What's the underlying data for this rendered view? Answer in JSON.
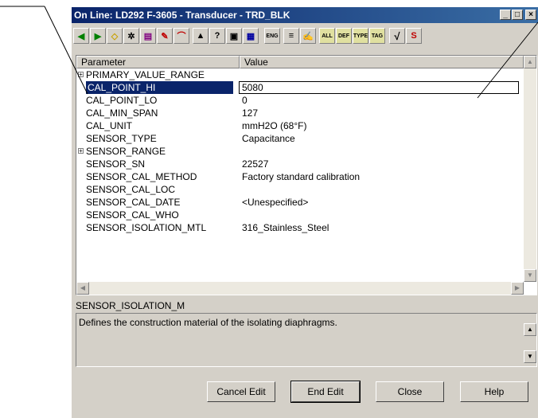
{
  "window": {
    "title": "On Line: LD292 F-3605 - Transducer - TRD_BLK"
  },
  "title_buttons": {
    "minimize": "_",
    "maximize": "□",
    "close": "×"
  },
  "toolbar": {
    "labels": {
      "all": "ALL",
      "def": "DEF",
      "type": "TYPE",
      "tag": "TAG",
      "eng": "ENG",
      "check": "√",
      "s": "S"
    }
  },
  "grid": {
    "headers": {
      "parameter": "Parameter",
      "value": "Value"
    },
    "rows": [
      {
        "name": "PRIMARY_VALUE_RANGE",
        "value": ""
      },
      {
        "name": "CAL_POINT_HI",
        "value": "5080"
      },
      {
        "name": "CAL_POINT_LO",
        "value": "0"
      },
      {
        "name": "CAL_MIN_SPAN",
        "value": "127"
      },
      {
        "name": "CAL_UNIT",
        "value": "mmH2O (68°F)"
      },
      {
        "name": "SENSOR_TYPE",
        "value": "Capacitance"
      },
      {
        "name": "SENSOR_RANGE",
        "value": ""
      },
      {
        "name": "SENSOR_SN",
        "value": "22527"
      },
      {
        "name": "SENSOR_CAL_METHOD",
        "value": "Factory standard calibration"
      },
      {
        "name": "SENSOR_CAL_LOC",
        "value": ""
      },
      {
        "name": "SENSOR_CAL_DATE",
        "value": "<Unespecified>"
      },
      {
        "name": "SENSOR_CAL_WHO",
        "value": ""
      },
      {
        "name": "SENSOR_ISOLATION_MTL",
        "value": "316_Stainless_Steel"
      }
    ]
  },
  "description": {
    "label": "SENSOR_ISOLATION_M",
    "text": "Defines the construction material of the isolating diaphragms."
  },
  "buttons": {
    "cancel_edit": "Cancel Edit",
    "end_edit": "End Edit",
    "close": "Close",
    "help": "Help"
  },
  "colors": {
    "title_bar": "#0a246a",
    "selection": "#0a246a",
    "face": "#d4d0c8"
  }
}
